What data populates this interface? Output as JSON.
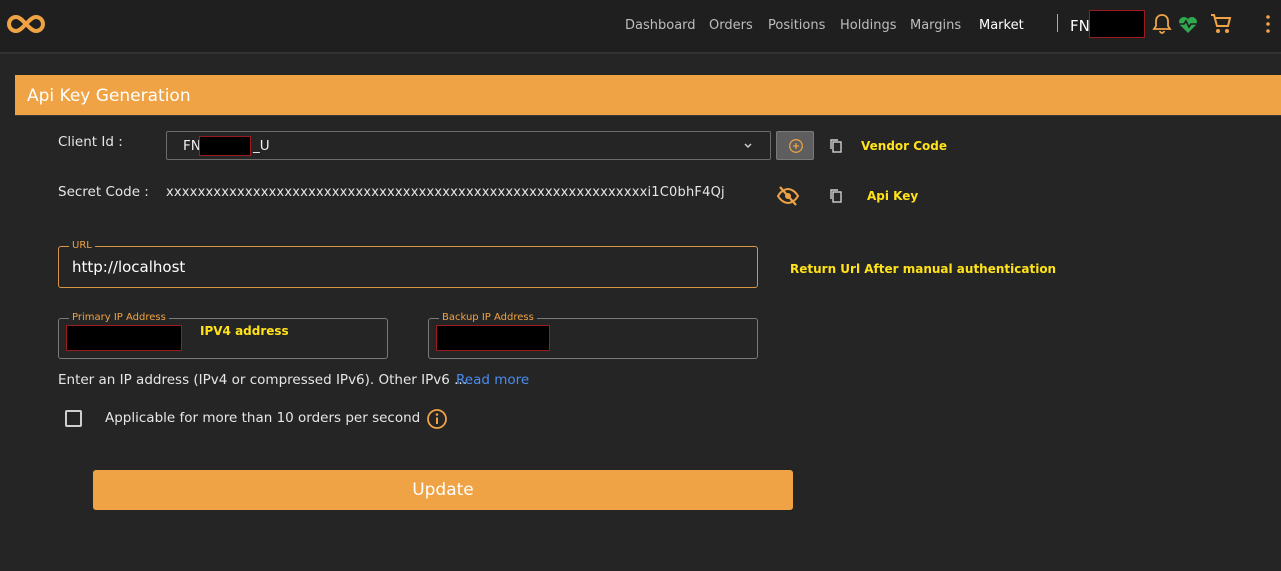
{
  "nav": {
    "items": [
      {
        "label": "Dashboard"
      },
      {
        "label": "Orders"
      },
      {
        "label": "Positions"
      },
      {
        "label": "Holdings"
      },
      {
        "label": "Margins"
      },
      {
        "label": "Market"
      }
    ],
    "active": "Market",
    "account_prefix": "FN"
  },
  "page": {
    "title": "Api Key Generation"
  },
  "form": {
    "client_id_label": "Client Id :",
    "client_id_prefix": "FN",
    "client_id_suffix": "_U",
    "vendor_code_label": "Vendor Code",
    "secret_label": "Secret Code :",
    "secret_value": "xxxxxxxxxxxxxxxxxxxxxxxxxxxxxxxxxxxxxxxxxxxxxxxxxxxxxxxxxxxxxi1C0bhF4Qj",
    "api_key_label": "Api Key",
    "url_label": "URL",
    "url_value": "http://localhost",
    "return_url_note": "Return Url After manual authentication",
    "primary_ip_label": "Primary IP Address",
    "ipv4_note": "IPV4 address",
    "backup_ip_label": "Backup IP Address",
    "ip_hint": "Enter an IP address (IPv4 or compressed IPv6). Other IPv6 ...",
    "read_more": "Read more",
    "checkbox_label": "Applicable for more than 10 orders per second",
    "update_label": "Update"
  },
  "colors": {
    "accent": "#efa345",
    "note_yellow": "#ffe21a",
    "link_blue": "#4a8df0",
    "health_green": "#2fa84f"
  },
  "icons": [
    "infinity-logo-icon",
    "bell-icon",
    "heartbeat-icon",
    "cart-icon",
    "kebab-menu-icon",
    "chevron-down-icon",
    "plus-circle-icon",
    "copy-icon",
    "eye-off-icon",
    "info-icon"
  ]
}
